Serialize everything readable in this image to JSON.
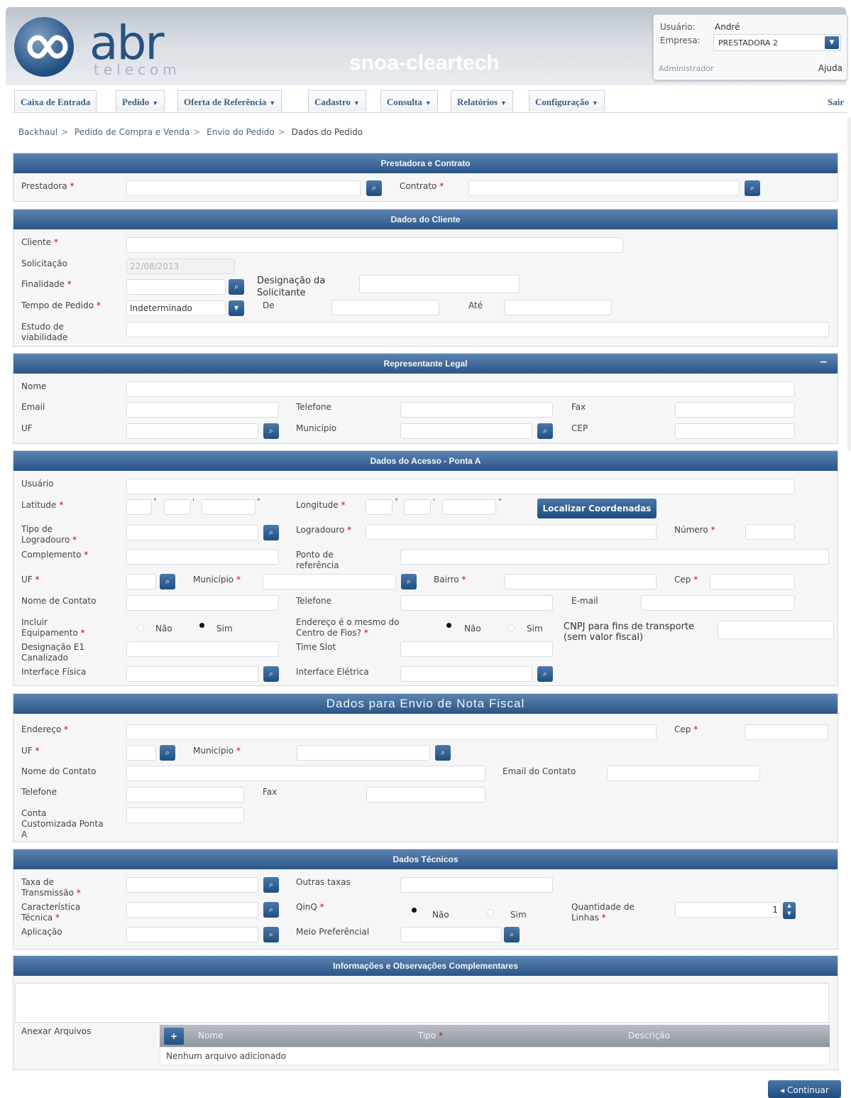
{
  "header": {
    "logo": "abr",
    "logo_sub": "telecom",
    "brand": "snoa-cleartech",
    "user_label": "Usuário:",
    "user_value": "André",
    "company_label": "Empresa:",
    "company_value": "PRESTADORA 2",
    "role": "Administrador",
    "help": "Ajuda"
  },
  "nav": {
    "items": [
      "Caixa de Entrada",
      "Pedido",
      "Oferta de Referência",
      "Cadastro",
      "Consulta",
      "Relatórios",
      "Configuração"
    ],
    "logout": "Sair"
  },
  "breadcrumb": [
    "Backhaul",
    "Pedido de Compra e Venda",
    "Envio do Pedido",
    "Dados do Pedido"
  ],
  "sections": {
    "prestadora": {
      "title": "Prestadora e Contrato",
      "prestadora": "Prestadora",
      "contrato": "Contrato"
    },
    "cliente": {
      "title": "Dados do Cliente",
      "cliente": "Cliente",
      "solicitacao": "Solicitação",
      "solicitacao_value": "22/08/2013",
      "finalidade": "Finalidade",
      "designacao_l1": "Designação da",
      "designacao_l2": "Solicitante",
      "tempo": "Tempo de Pedido",
      "tempo_value": "Indeterminado",
      "de": "De",
      "ate": "Até",
      "estudo_l1": "Estudo de",
      "estudo_l2": "viabilidade"
    },
    "representante": {
      "title": "Representante Legal",
      "collapse": "−",
      "nome": "Nome",
      "email": "Email",
      "telefone": "Telefone",
      "fax": "Fax",
      "uf": "UF",
      "municipio": "Município",
      "cep": "CEP"
    },
    "acesso": {
      "title": "Dados do Acesso - Ponta A",
      "usuario": "Usuário",
      "latitude": "Latitude",
      "longitude": "Longitude",
      "localizar": "Localizar Coordenadas",
      "tipo_l1": "Tipo de",
      "tipo_l2": "Logradouro",
      "logradouro": "Logradouro",
      "numero": "Número",
      "complemento": "Complemento",
      "ponto_l1": "Ponto de",
      "ponto_l2": "referência",
      "uf": "UF",
      "municipio": "Município",
      "bairro": "Bairro",
      "cep": "Cep",
      "contato": "Nome de Contato",
      "telefone": "Telefone",
      "email": "E-mail",
      "incluir_l1": "Incluir",
      "incluir_l2": "Equipamento",
      "nao": "Não",
      "sim": "Sim",
      "endereco_l1": "Endereço é o mesmo do",
      "endereco_l2": "Centro de Fios?",
      "cnpj_l1": "CNPJ para fins de transporte",
      "cnpj_l2": "(sem valor fiscal)",
      "designacao_l1": "Designação E1",
      "designacao_l2": "Canalizado",
      "timeslot": "Time Slot",
      "interface_fisica": "Interface Física",
      "interface_eletrica": "Interface Elétrica"
    },
    "nota": {
      "title": "Dados para Envio de Nota Fiscal",
      "endereco": "Endereço",
      "cep": "Cep",
      "uf": "UF",
      "municipio": "Município",
      "contato": "Nome do Contato",
      "email": "Email do Contato",
      "telefone": "Telefone",
      "fax": "Fax",
      "conta_l1": "Conta",
      "conta_l2": "Customizada Ponta",
      "conta_l3": "A"
    },
    "tecnicos": {
      "title": "Dados Técnicos",
      "taxa_l1": "Taxa de",
      "taxa_l2": "Transmissão",
      "outras": "Outras taxas",
      "carac_l1": "Característica",
      "carac_l2": "Técnica",
      "qinq": "QinQ",
      "nao": "Não",
      "sim": "Sim",
      "qtd_l1": "Quantidade de",
      "qtd_l2": "Linhas",
      "qtd_value": "1",
      "aplicacao": "Aplicação",
      "meio": "Meio Preferêncial"
    },
    "info": {
      "title": "Informações e Observações Complementares",
      "anexar": "Anexar Arquivos",
      "col_nome": "Nome",
      "col_tipo": "Tipo",
      "col_descricao": "Descrição",
      "add": "+",
      "empty": "Nenhum arquivo adicionado"
    }
  },
  "footer": {
    "continuar": "Continuar"
  },
  "colors": {
    "panel_header": "#2a5588",
    "accent": "#3b5e86",
    "required": "#d0021b"
  },
  "icons": {
    "search": "magnifier-icon",
    "dropdown": "chevron-down-icon",
    "spinner": "spinner-icon"
  }
}
